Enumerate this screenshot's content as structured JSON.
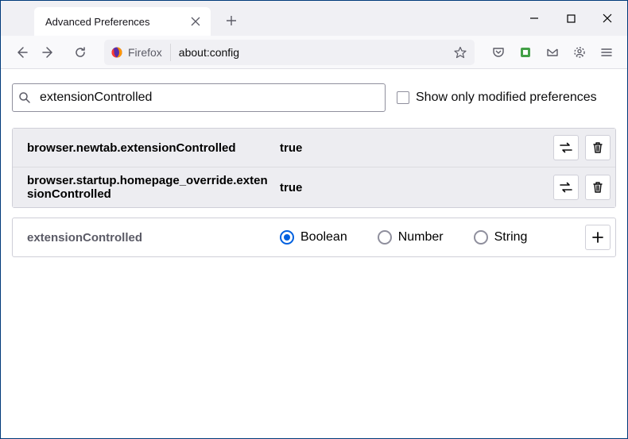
{
  "tab": {
    "title": "Advanced Preferences"
  },
  "urlbar": {
    "identity": "Firefox",
    "url": "about:config"
  },
  "search": {
    "value": "extensionControlled",
    "checkbox_label": "Show only modified preferences"
  },
  "prefs": [
    {
      "name": "browser.newtab.extensionControlled",
      "value": "true"
    },
    {
      "name": "browser.startup.homepage_override.extensionControlled",
      "value": "true"
    }
  ],
  "newpref": {
    "name": "extensionControlled",
    "types": [
      "Boolean",
      "Number",
      "String"
    ],
    "selected": 0
  }
}
